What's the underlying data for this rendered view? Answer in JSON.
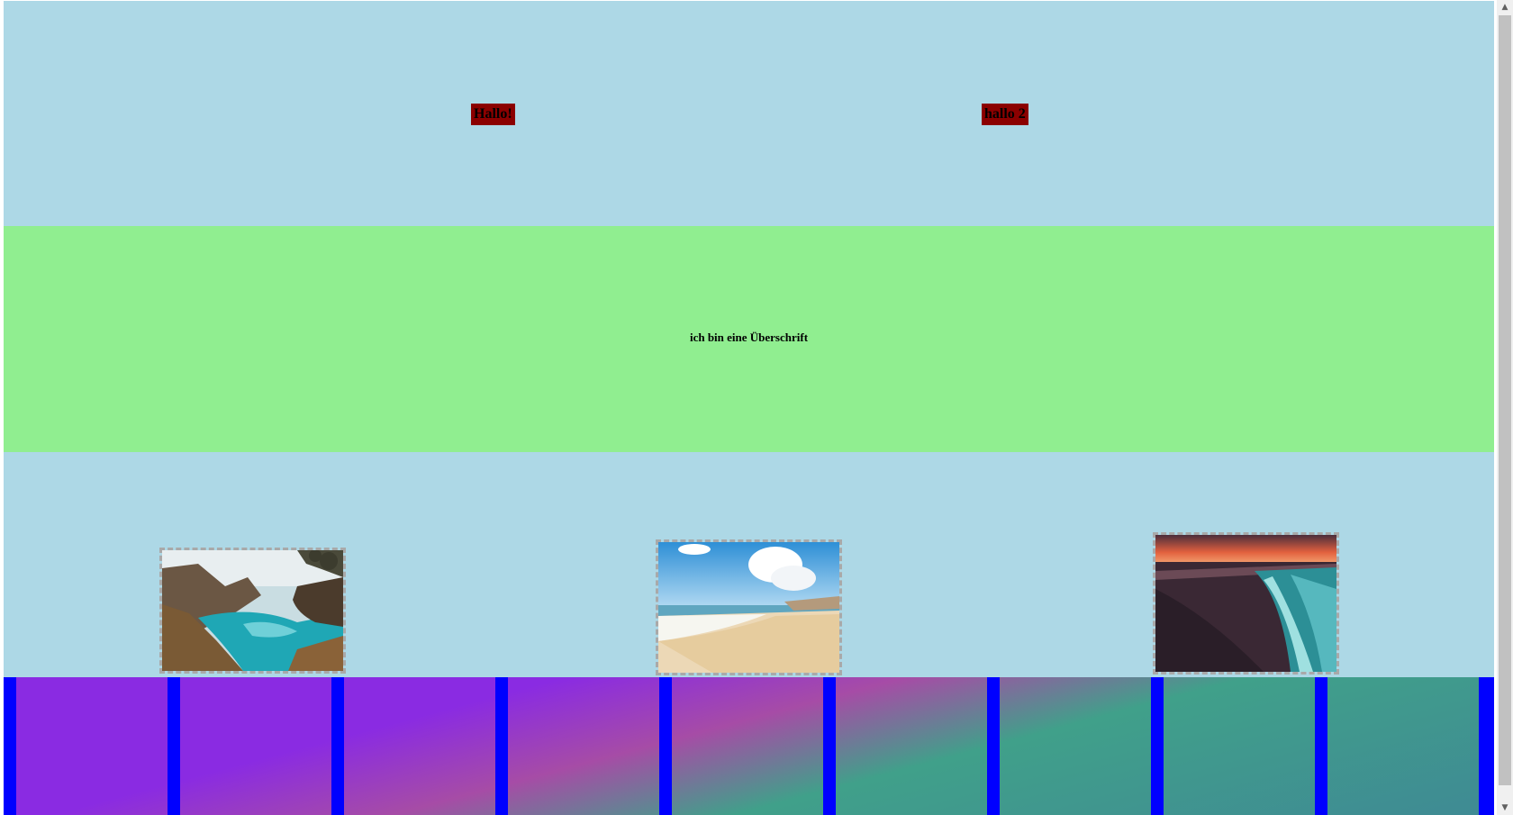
{
  "header": {
    "greeting_1": "Hallo!",
    "greeting_2": "hallo 2"
  },
  "main": {
    "headline": "ich bin eine Überschrift"
  },
  "gallery": {
    "images": [
      {
        "subject": "coastal cove with waterfall and turquoise water"
      },
      {
        "subject": "sandy beach with blue sky and clouds"
      },
      {
        "subject": "shoreline waves at sunset"
      }
    ]
  },
  "strip": {
    "tile_count": 9,
    "gradient_colors": [
      "#8a2be2",
      "#a64ca6",
      "#40a08a",
      "#3f8a94"
    ]
  },
  "scrollbar": {
    "up_icon": "triangle-up-icon",
    "down_icon": "triangle-down-icon"
  },
  "colors": {
    "top_section": "#add8e6",
    "middle_section": "#90ee90",
    "greeting_background": "#8b0000",
    "strip_background": "#0000ff",
    "photo_border": "#a9a9a9"
  }
}
